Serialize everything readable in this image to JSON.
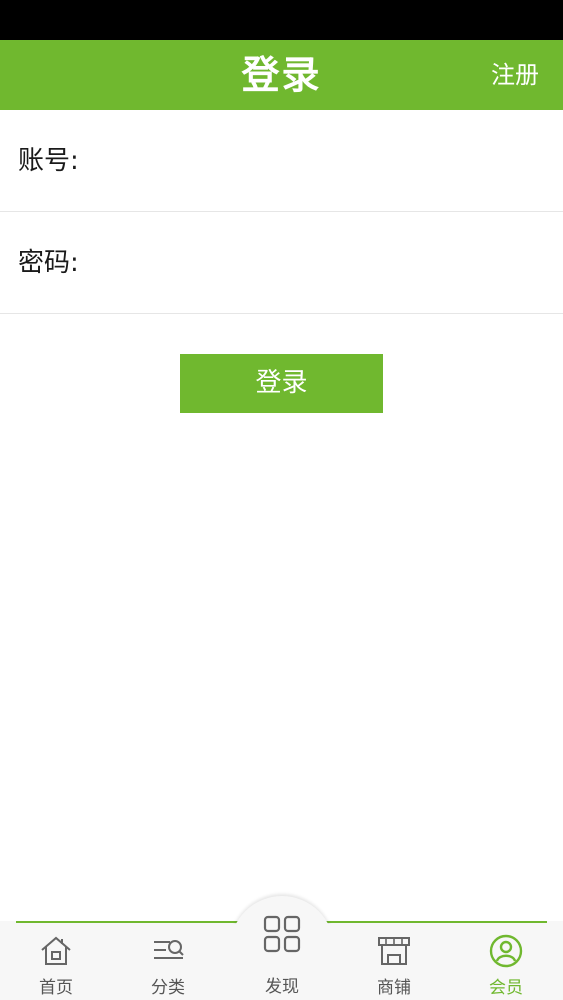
{
  "header": {
    "title": "登录",
    "register_label": "注册"
  },
  "form": {
    "account_label": "账号:",
    "account_value": "",
    "password_label": "密码:",
    "password_value": ""
  },
  "login_button": "登录",
  "tabbar": {
    "items": [
      {
        "label": "首页",
        "icon": "home-icon",
        "active": false
      },
      {
        "label": "分类",
        "icon": "category-search-icon",
        "active": false
      },
      {
        "label": "发现",
        "icon": "grid-icon",
        "active": false
      },
      {
        "label": "商铺",
        "icon": "shop-icon",
        "active": false
      },
      {
        "label": "会员",
        "icon": "user-circle-icon",
        "active": true
      }
    ]
  },
  "colors": {
    "brand": "#70b82f",
    "status_bar": "#000000",
    "tab_inactive": "#555555"
  }
}
